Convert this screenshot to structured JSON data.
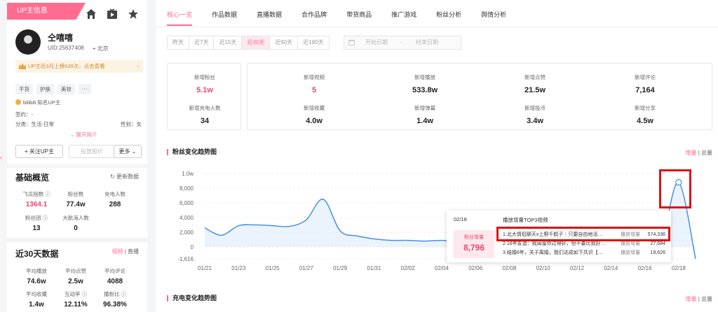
{
  "left": {
    "badge": "UP主信息",
    "name": "仝嘻嘻",
    "uid": "UID:25637408",
    "location": "北京",
    "rank_text": "UP主近3月上榜639次，点击查看",
    "tags": [
      "干货",
      "护肤",
      "美妆",
      "···"
    ],
    "bili_text": "bilibili 知名UP主",
    "sign_label": "签约：",
    "sign_value": "-",
    "category_label": "分类：",
    "category_value": "生活-日常",
    "gender_label": "性别：",
    "gender_value": "女",
    "expand": "展开简介",
    "follow_btn": "+ 关注UP主",
    "report_btn": "投放报价",
    "more_btn": "更多",
    "basic_title": "基础概览",
    "refresh": "更新数据",
    "basic_stats": [
      {
        "label": "飞瓜指数",
        "value": "1364.1"
      },
      {
        "label": "粉丝数",
        "value": "77.4w"
      },
      {
        "label": "充电人数",
        "value": "288"
      },
      {
        "label": "粉丝团",
        "value": "13"
      },
      {
        "label": "大航海人数",
        "value": "0"
      }
    ],
    "recent_title": "近30天数据",
    "switch_video": "视频",
    "switch_live": "直播",
    "recent_stats": [
      {
        "label": "平均播放",
        "value": "74.6w"
      },
      {
        "label": "平均点赞",
        "value": "2.5w"
      },
      {
        "label": "平均评论",
        "value": "4088"
      },
      {
        "label": "平均收藏",
        "value": "1.4w"
      },
      {
        "label": "互动率",
        "value": "12.11%"
      },
      {
        "label": "播粉比",
        "value": "96.38%"
      }
    ]
  },
  "tabs": [
    "核心一览",
    "作品数据",
    "直播数据",
    "合作品牌",
    "带货商品",
    "推广游戏",
    "粉丝分析",
    "舆情分析"
  ],
  "periods": [
    "昨天",
    "近7天",
    "近15天",
    "近30天",
    "近90天",
    "近180天"
  ],
  "date_start_placeholder": "开始日期",
  "date_sep": "-",
  "date_end_placeholder": "结束日期",
  "metrics_left": [
    {
      "label": "新增粉丝",
      "value": "5.1w"
    },
    {
      "label": "新增充电人数",
      "value": "34"
    }
  ],
  "metrics_right": [
    {
      "label": "新增视频",
      "value": "5"
    },
    {
      "label": "新增播放",
      "value": "533.8w"
    },
    {
      "label": "新增点赞",
      "value": "21.5w"
    },
    {
      "label": "新增评论",
      "value": "7,164"
    },
    {
      "label": "新增收藏",
      "value": "4.0w"
    },
    {
      "label": "新增弹幕",
      "value": "1.4w"
    },
    {
      "label": "新增投币",
      "value": "3.4w"
    },
    {
      "label": "新增分享",
      "value": "4.5w"
    }
  ],
  "chart1_title": "粉丝变化趋势图",
  "chart2_title": "充电变化趋势图",
  "toggle_inc": "增量",
  "toggle_total": "总量",
  "colors": {
    "accent": "#ff6c8f",
    "line": "#4a90e2",
    "highlight": "#e01010"
  },
  "chart_data": {
    "type": "area",
    "x": [
      "01/21",
      "01/22",
      "01/23",
      "01/24",
      "01/25",
      "01/26",
      "01/27",
      "01/28",
      "01/29",
      "01/30",
      "01/31",
      "02/01",
      "02/02",
      "02/03",
      "02/04",
      "02/05",
      "02/06",
      "02/07",
      "02/08",
      "02/09",
      "02/10",
      "02/11",
      "02/12",
      "02/13",
      "02/14",
      "02/15",
      "02/16",
      "02/17",
      "02/18",
      "02/19"
    ],
    "x_ticks": [
      "01/21",
      "01/23",
      "01/25",
      "01/27",
      "01/29",
      "01/31",
      "02/02",
      "02/04",
      "02/06",
      "02/08",
      "02/10",
      "02/12",
      "02/14",
      "02/16",
      "02/18"
    ],
    "y": [
      2600,
      1600,
      2900,
      3000,
      2900,
      2800,
      3700,
      6500,
      2200,
      1500,
      1100,
      900,
      900,
      800,
      900,
      700,
      600,
      600,
      500,
      500,
      400,
      400,
      300,
      300,
      300,
      400,
      800,
      1200,
      8796,
      -1616
    ],
    "y_ticks": [
      "1.0w",
      "8,000",
      "6,000",
      "4,000",
      "2,000",
      "0",
      "-1,616"
    ],
    "ylim": [
      -1616,
      10000
    ],
    "grid": true
  },
  "tooltip": {
    "date": "02/18",
    "header": "播放增量TOP3视频",
    "box_label": "粉丝增量",
    "box_value": "8,796",
    "play_label": "播放增量",
    "videos": [
      {
        "title": "1.北大情侣聊天x上野千鹤子｜只要自由地活…",
        "value": "574,336"
      },
      {
        "title": "2.16年友谊：我闺蜜你过得好，但不要比我好…",
        "value": "27,684"
      },
      {
        "title": "3.结婚6年，关于离婚，我们达成如下共识【…",
        "value": "19,626"
      }
    ]
  }
}
